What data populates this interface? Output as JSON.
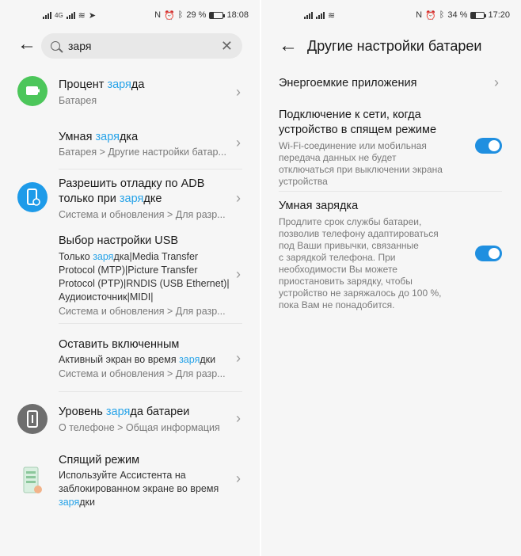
{
  "left": {
    "status": {
      "network": "4G",
      "battery": "29 %",
      "time": "18:08",
      "battery_level": 0.29
    },
    "search": {
      "query": "заря"
    },
    "results": [
      {
        "title_pre": "Процент ",
        "title_hl": "заря",
        "title_post": "да",
        "sub1": "Батарея",
        "icon": "battery-icon"
      },
      {
        "title_pre": "Умная ",
        "title_hl": "заря",
        "title_post": "дка",
        "sub1": "Батарея > Другие настройки батар..."
      },
      {
        "title_line1": "Разрешить отладку по ADB",
        "title_pre": "только при ",
        "title_hl": "заря",
        "title_post": "дке",
        "sub1": "Система и обновления > Для разр...",
        "icon": "phone-settings-icon"
      },
      {
        "title": "Выбор настройки USB",
        "d1_pre": "Только ",
        "d1_hl": "заря",
        "d1_post": "дка|Media Transfer",
        "d2": "Protocol (MTP)|Picture Transfer",
        "d3": "Protocol (PTP)|RNDIS (USB Ethernet)|",
        "d4": "Аудиоисточник|MIDI|",
        "sub1": "Система и обновления > Для разр..."
      },
      {
        "title": "Оставить включенным",
        "d1_pre": "Активный экран во время ",
        "d1_hl": "заря",
        "d1_post": "дки",
        "sub1": "Система и обновления > Для разр..."
      },
      {
        "title_pre": "Уровень ",
        "title_hl": "заря",
        "title_post": "да батареи",
        "sub1": "О телефоне > Общая информация",
        "icon": "phone-info-icon"
      },
      {
        "title": "Спящий режим",
        "d1": "Используйте Ассистента на",
        "d2": "заблокированном экране во время",
        "d3_hl": "заря",
        "d3_post": "дки",
        "icon": "sleep-mode-icon"
      }
    ]
  },
  "right": {
    "status": {
      "battery": "34 %",
      "time": "17:20",
      "battery_level": 0.34
    },
    "title": "Другие настройки батареи",
    "items": [
      {
        "title": "Энергоемкие приложения"
      },
      {
        "title1": "Подключение к сети, когда",
        "title2": "устройство в спящем режиме",
        "desc": [
          "Wi-Fi-соединение или мобильная",
          "передача данных не будет",
          "отключаться при выключении экрана",
          "устройства"
        ],
        "toggle": true
      },
      {
        "title1": "Умная зарядка",
        "desc": [
          "Продлите срок службы батареи,",
          "позволив телефону адаптироваться",
          "под Ваши привычки, связанные",
          "с зарядкой телефона. При",
          "необходимости Вы можете",
          "приостановить зарядку, чтобы",
          "устройство не заряжалось до 100 %,",
          "пока Вам не понадобится."
        ],
        "toggle": true
      }
    ]
  },
  "colors": {
    "accent": "#27a3e8",
    "toggle": "#1f8fe0",
    "green": "#4cc65a",
    "blue": "#1e9be9",
    "gray": "#6e6e6e"
  }
}
